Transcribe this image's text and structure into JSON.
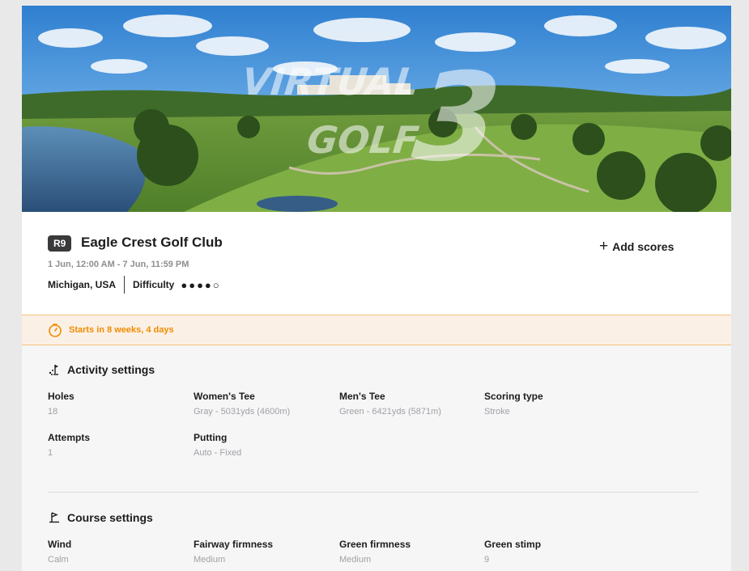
{
  "hero": {
    "logo_line1": "VIRTUAL",
    "logo_line2": "GOLF",
    "logo_number": "3"
  },
  "event": {
    "round_badge": "R9",
    "club_name": "Eagle Crest Golf Club",
    "dates": "1 Jun, 12:00 AM - 7 Jun, 11:59 PM",
    "location": "Michigan, USA",
    "difficulty_label": "Difficulty",
    "difficulty_dots": "●●●●○",
    "difficulty_level": 4,
    "difficulty_max": 5,
    "add_scores_label": "Add scores"
  },
  "countdown": {
    "text": "Starts in 8 weeks, 4 days",
    "accent": "#f08c00"
  },
  "activity": {
    "title": "Activity settings",
    "icon": "golf-ball-flag-icon",
    "fields": [
      {
        "label": "Holes",
        "value": "18"
      },
      {
        "label": "Women's Tee",
        "value": "Gray - 5031yds (4600m)"
      },
      {
        "label": "Men's Tee",
        "value": "Green - 6421yds (5871m)"
      },
      {
        "label": "Scoring type",
        "value": "Stroke"
      },
      {
        "label": "Attempts",
        "value": "1"
      },
      {
        "label": "Putting",
        "value": "Auto - Fixed"
      }
    ]
  },
  "course": {
    "title": "Course settings",
    "icon": "golf-flag-icon",
    "fields": [
      {
        "label": "Wind",
        "value": "Calm"
      },
      {
        "label": "Fairway firmness",
        "value": "Medium"
      },
      {
        "label": "Green firmness",
        "value": "Medium"
      },
      {
        "label": "Green stimp",
        "value": "9"
      }
    ]
  }
}
